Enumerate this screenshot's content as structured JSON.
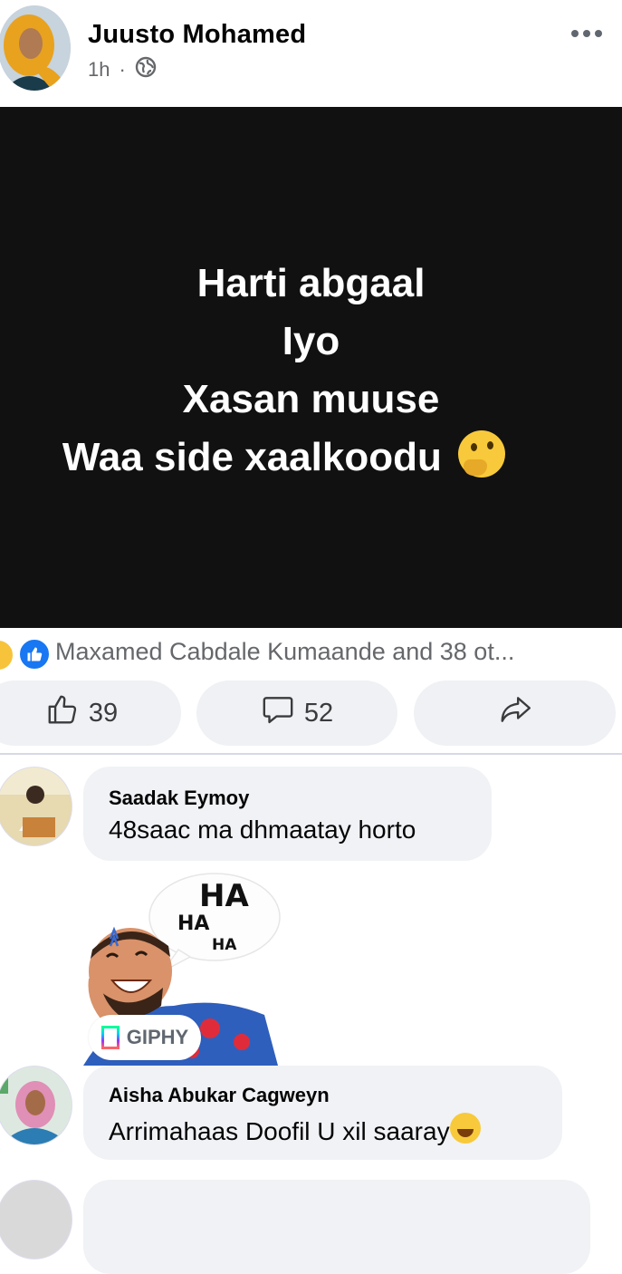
{
  "post": {
    "author": "Juusto Mohamed",
    "time": "1h",
    "separator": "·",
    "privacy_icon": "globe-icon",
    "text_lines": [
      "Harti abgaal",
      "Iyo",
      "Xasan muuse",
      "Waa side xaalkoodu"
    ],
    "text_emoji": "thinking-face"
  },
  "reactions": {
    "summary": "Maxamed Cabdale Kumaande and 38 ot...",
    "icons": [
      "haha-reaction-icon",
      "like-reaction-icon"
    ]
  },
  "actions": {
    "like_count": "39",
    "comment_count": "52"
  },
  "comments": [
    {
      "name": "Saadak Eymoy",
      "text": "48saac ma dhmaatay horto"
    },
    {
      "name": "Aisha Abukar Cagweyn",
      "text": "Arrimahaas Doofil U xil saaray",
      "emoji": "tears-of-joy"
    }
  ],
  "gif": {
    "badge": "GIPHY",
    "bubble_text": [
      "HA",
      "HA",
      "HA"
    ]
  },
  "colors": {
    "post_background": "#111111",
    "like_blue": "#1877f2",
    "bubble_gray": "#f0f2f5",
    "meta_gray": "#65676b"
  }
}
